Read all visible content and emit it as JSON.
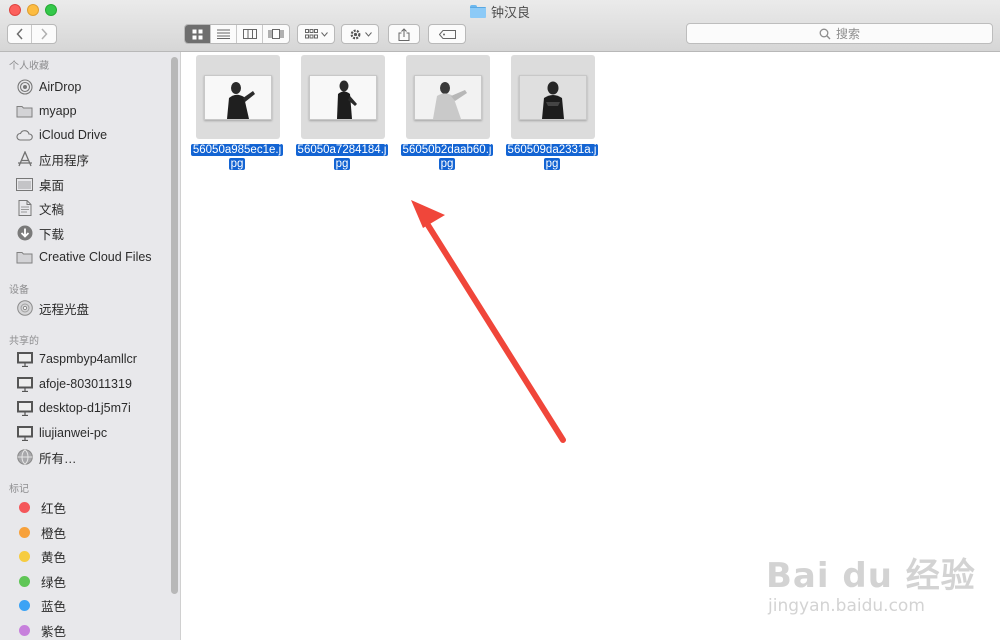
{
  "window": {
    "title": "钟汉良"
  },
  "toolbar": {
    "search_placeholder": "搜索"
  },
  "sidebar": {
    "favorites_header": "个人收藏",
    "favorites": [
      {
        "label": "AirDrop",
        "icon": "airdrop-icon"
      },
      {
        "label": "myapp",
        "icon": "folder-icon"
      },
      {
        "label": "iCloud Drive",
        "icon": "cloud-icon"
      },
      {
        "label": "应用程序",
        "icon": "applications-icon"
      },
      {
        "label": "桌面",
        "icon": "desktop-icon"
      },
      {
        "label": "文稿",
        "icon": "document-icon"
      },
      {
        "label": "下载",
        "icon": "download-icon"
      },
      {
        "label": "Creative Cloud Files",
        "icon": "folder-icon"
      }
    ],
    "devices_header": "设备",
    "devices": [
      {
        "label": "远程光盘",
        "icon": "disc-icon"
      }
    ],
    "shared_header": "共享的",
    "shared": [
      {
        "label": "7aspmbyp4amllcr",
        "icon": "computer-icon"
      },
      {
        "label": "afoje-803011319",
        "icon": "computer-icon"
      },
      {
        "label": "desktop-d1j5m7i",
        "icon": "computer-icon"
      },
      {
        "label": "liujianwei-pc",
        "icon": "computer-icon"
      },
      {
        "label": "所有…",
        "icon": "globe-icon"
      }
    ],
    "tags_header": "标记",
    "tags": [
      {
        "label": "红色",
        "color": "#f4575a"
      },
      {
        "label": "橙色",
        "color": "#f7a13b"
      },
      {
        "label": "黄色",
        "color": "#f6cc40"
      },
      {
        "label": "绿色",
        "color": "#5fc656"
      },
      {
        "label": "蓝色",
        "color": "#3ba3f5"
      },
      {
        "label": "紫色",
        "color": "#c780dc"
      }
    ]
  },
  "files": [
    {
      "name_line1": "56050a985ec1e.j",
      "name_line2": "pg"
    },
    {
      "name_line1": "56050a7284184.j",
      "name_line2": "pg"
    },
    {
      "name_line1": "56050b2daab60.j",
      "name_line2": "pg"
    },
    {
      "name_line1": "560509da2331a.j",
      "name_line2": "pg"
    }
  ],
  "colors": {
    "selection": "#1364d3",
    "annotation_arrow": "#f0463a"
  },
  "watermark": {
    "main": "Bai du 经验",
    "sub": "jingyan.baidu.com"
  }
}
